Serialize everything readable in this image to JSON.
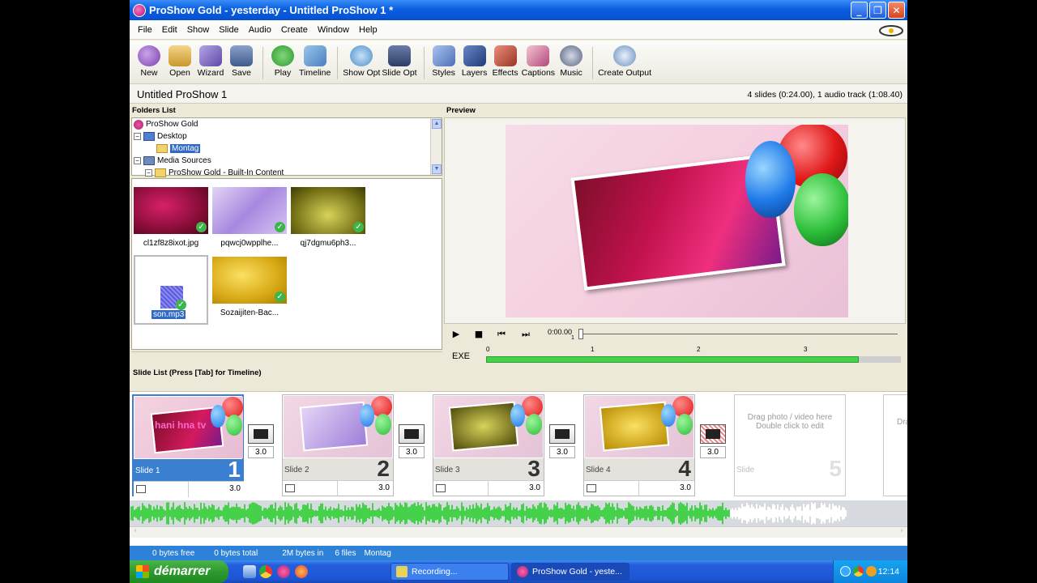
{
  "window": {
    "title": "ProShow Gold - yesterday - Untitled ProShow 1 *",
    "controls": [
      "minimize-icon",
      "restore-icon",
      "close-icon"
    ]
  },
  "menu": [
    "File",
    "Edit",
    "Show",
    "Slide",
    "Audio",
    "Create",
    "Window",
    "Help"
  ],
  "toolbar": [
    {
      "label": "New",
      "icon": "new-icon"
    },
    {
      "label": "Open",
      "icon": "open-icon"
    },
    {
      "label": "Wizard",
      "icon": "wizard-icon"
    },
    {
      "label": "Save",
      "icon": "save-icon"
    },
    {
      "label": "Play",
      "icon": "play-icon"
    },
    {
      "label": "Timeline",
      "icon": "timeline-icon"
    },
    {
      "label": "Show Opt",
      "icon": "show-opt-icon"
    },
    {
      "label": "Slide Opt",
      "icon": "slide-opt-icon"
    },
    {
      "label": "Styles",
      "icon": "styles-icon"
    },
    {
      "label": "Layers",
      "icon": "layers-icon"
    },
    {
      "label": "Effects",
      "icon": "effects-icon"
    },
    {
      "label": "Captions",
      "icon": "captions-icon"
    },
    {
      "label": "Music",
      "icon": "music-icon"
    },
    {
      "label": "Create Output",
      "icon": "create-output-icon"
    }
  ],
  "project": {
    "title": "Untitled ProShow 1",
    "info": "4 slides (0:24.00), 1 audio track (1:08.40)"
  },
  "folders": {
    "header": "Folders List",
    "items": [
      "ProShow Gold",
      "Desktop",
      "Montag",
      "Media Sources",
      "ProShow Gold - Built-In Content"
    ]
  },
  "files": [
    {
      "name": "cl1zf8z8ixot.jpg",
      "checked": true
    },
    {
      "name": "pqwcj0wpplhe...",
      "checked": true
    },
    {
      "name": "qj7dgmu6ph3...",
      "checked": true
    },
    {
      "name": "son.mp3",
      "checked": true,
      "selected": true
    },
    {
      "name": "Sozaijiten-Bac...",
      "checked": true
    }
  ],
  "preview": {
    "header": "Preview",
    "timecode": "0:00.00",
    "timecode_sub": "1",
    "exe": "EXE",
    "ruler_ticks": [
      "0",
      "1",
      "2",
      "3"
    ]
  },
  "slide_list": {
    "header": "Slide List (Press [Tab] for Timeline)",
    "slides": [
      {
        "name": "Slide 1",
        "number": "1",
        "duration": "3.0",
        "caption": "hani hna tv",
        "selected": true
      },
      {
        "name": "Slide 2",
        "number": "2",
        "duration": "3.0"
      },
      {
        "name": "Slide 3",
        "number": "3",
        "duration": "3.0"
      },
      {
        "name": "Slide 4",
        "number": "4",
        "duration": "3.0"
      }
    ],
    "transitions": [
      "3.0",
      "3.0",
      "3.0",
      "3.0"
    ],
    "empty_slide": {
      "hint": "Drag photo / video here Double click to edit",
      "name": "Slide",
      "number": "5"
    },
    "partial_hint": "Dra"
  },
  "status": [
    "0 bytes free",
    "0 bytes total",
    "2M bytes in",
    "6 files",
    "Montag"
  ],
  "taskbar": {
    "start": "démarrer",
    "tasks": [
      "Recording...",
      "ProShow Gold - yeste..."
    ],
    "clock": "12:14"
  },
  "colors": {
    "accent": "#2d81d9",
    "selection": "#3a7fd0",
    "waveform": "#46d14a"
  }
}
